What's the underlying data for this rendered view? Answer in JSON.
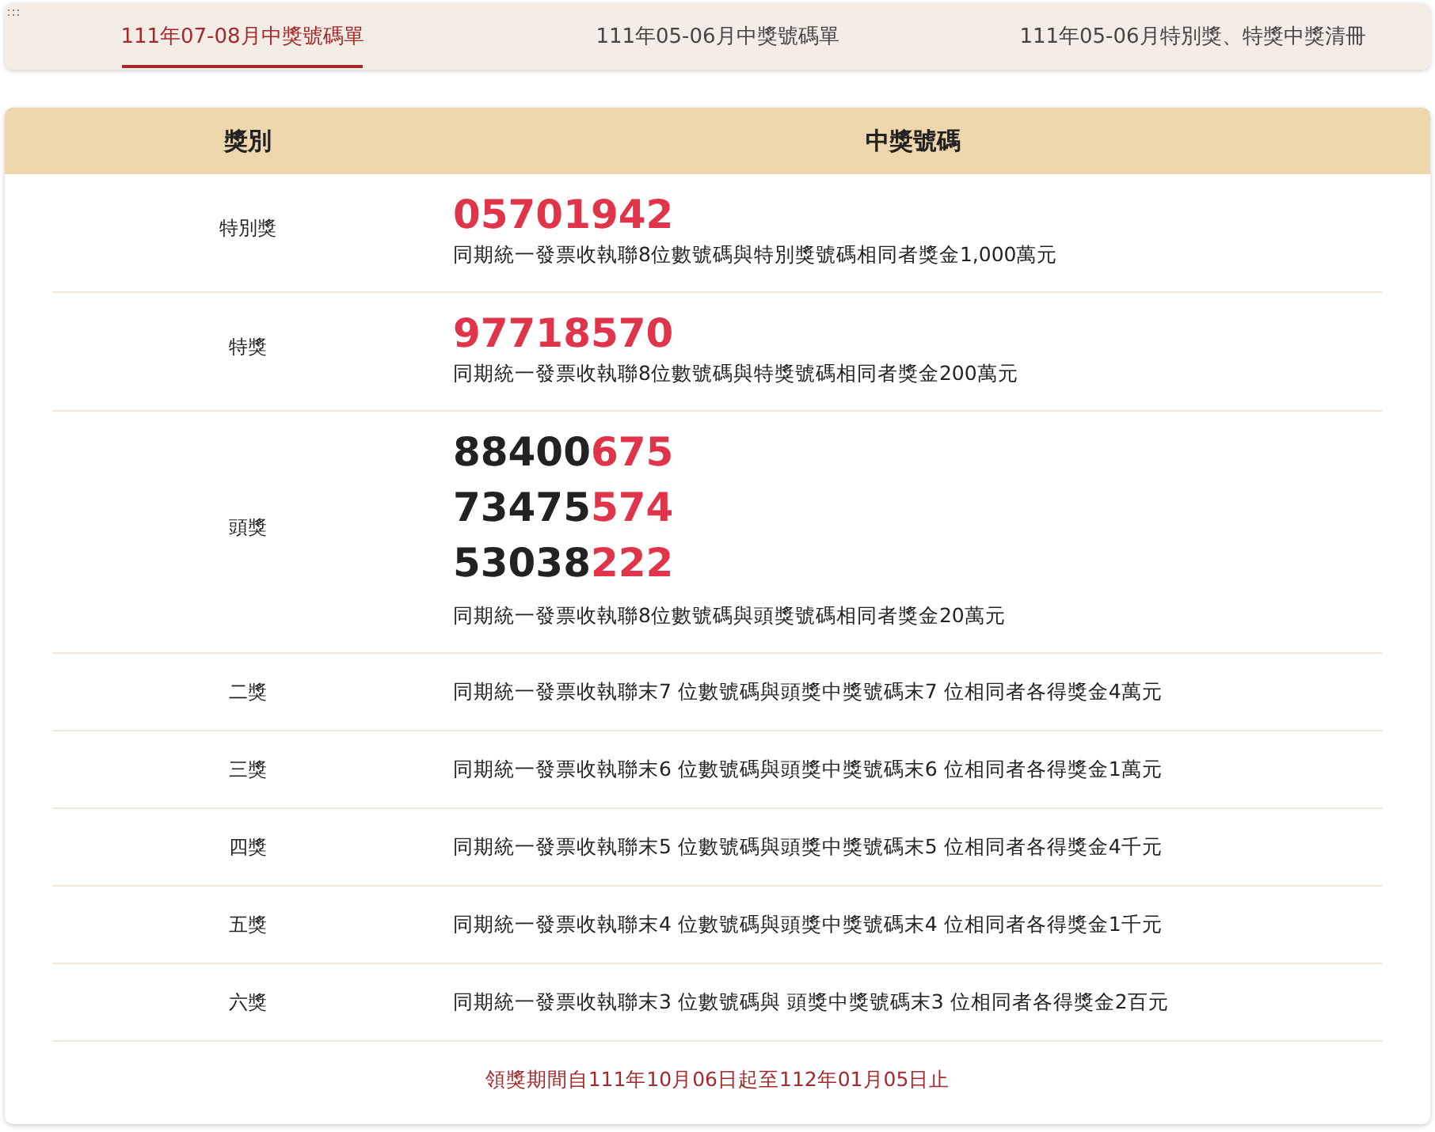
{
  "tabs": [
    {
      "label": "111年07-08月中獎號碼單",
      "selected": true
    },
    {
      "label": "111年05-06月中獎號碼單",
      "selected": false
    },
    {
      "label": "111年05-06月特別獎、特獎中獎清冊",
      "selected": false
    }
  ],
  "table": {
    "columns": [
      "獎別",
      "中獎號碼"
    ],
    "rows": [
      {
        "prize": "特別獎",
        "numbers": [
          [
            {
              "text": "05701942",
              "highlight": true
            }
          ]
        ],
        "description": "同期統一發票收執聯8位數號碼與特別獎號碼相同者獎金1,000萬元"
      },
      {
        "prize": "特獎",
        "numbers": [
          [
            {
              "text": "97718570",
              "highlight": true
            }
          ]
        ],
        "description": "同期統一發票收執聯8位數號碼與特獎號碼相同者獎金200萬元"
      },
      {
        "prize": "頭獎",
        "numbers": [
          [
            {
              "text": "88400",
              "highlight": false
            },
            {
              "text": "675",
              "highlight": true
            }
          ],
          [
            {
              "text": "73475",
              "highlight": false
            },
            {
              "text": "574",
              "highlight": true
            }
          ],
          [
            {
              "text": "53038",
              "highlight": false
            },
            {
              "text": "222",
              "highlight": true
            }
          ]
        ],
        "description": "同期統一發票收執聯8位數號碼與頭獎號碼相同者獎金20萬元"
      },
      {
        "prize": "二獎",
        "description": "同期統一發票收執聯末7 位數號碼與頭獎中獎號碼末7 位相同者各得獎金4萬元"
      },
      {
        "prize": "三獎",
        "description": "同期統一發票收執聯末6 位數號碼與頭獎中獎號碼末6 位相同者各得獎金1萬元"
      },
      {
        "prize": "四獎",
        "description": "同期統一發票收執聯末5 位數號碼與頭獎中獎號碼末5 位相同者各得獎金4千元"
      },
      {
        "prize": "五獎",
        "description": "同期統一發票收執聯末4 位數號碼與頭獎中獎號碼末4 位相同者各得獎金1千元"
      },
      {
        "prize": "六獎",
        "description": "同期統一發票收執聯末3 位數號碼與 頭獎中獎號碼末3 位相同者各得獎金2百元"
      }
    ],
    "footer": "領獎期間自111年10月06日起至112年01月05日止"
  }
}
